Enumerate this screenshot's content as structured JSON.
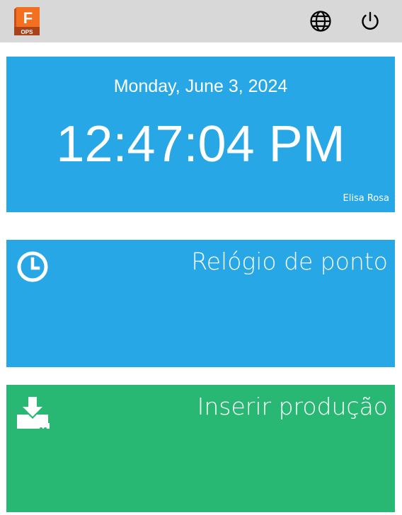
{
  "header": {
    "logo_letter": "F",
    "logo_label": "OPS",
    "icons": {
      "language": "globe-icon",
      "power": "power-icon"
    }
  },
  "clock": {
    "date": "Monday, June 3, 2024",
    "time": "12:47:04 PM",
    "user": "Elisa Rosa"
  },
  "tiles": [
    {
      "label": "Relógio de ponto",
      "icon": "clock-icon",
      "color": "#27a7e5"
    },
    {
      "label": "Inserir produção",
      "icon": "download-icon",
      "color": "#29b874"
    }
  ],
  "colors": {
    "topbar": "#d8d8d8",
    "accent_blue": "#27a7e5",
    "accent_green": "#29b874",
    "logo_orange": "#f37021"
  }
}
